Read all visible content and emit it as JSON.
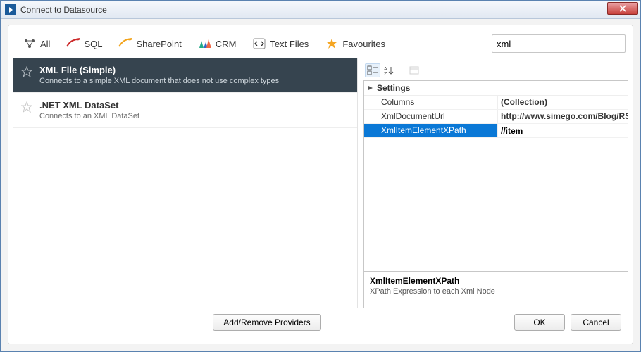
{
  "window": {
    "title": "Connect to Datasource"
  },
  "toolbar": {
    "items": [
      {
        "name": "all",
        "label": "All"
      },
      {
        "name": "sql",
        "label": "SQL"
      },
      {
        "name": "sharepoint",
        "label": "SharePoint"
      },
      {
        "name": "crm",
        "label": "CRM"
      },
      {
        "name": "textfiles",
        "label": "Text Files"
      },
      {
        "name": "favourites",
        "label": "Favourites"
      }
    ],
    "search_value": "xml"
  },
  "providers": [
    {
      "id": "xml-simple",
      "title": "XML File (Simple)",
      "desc": "Connects to a simple XML document that does not use complex types",
      "selected": true
    },
    {
      "id": "net-xml-dataset",
      "title": ".NET XML DataSet",
      "desc": "Connects to an XML DataSet",
      "selected": false
    }
  ],
  "propgrid": {
    "category": "Settings",
    "rows": [
      {
        "name": "Columns",
        "value": "(Collection)",
        "bold": true,
        "selected": false
      },
      {
        "name": "XmlDocumentUrl",
        "value": "http://www.simego.com/Blog/RSS",
        "bold": true,
        "selected": false
      },
      {
        "name": "XmlItemElementXPath",
        "value": "//item",
        "bold": true,
        "selected": true
      }
    ],
    "help": {
      "title": "XmlItemElementXPath",
      "desc": "XPath Expression to each Xml Node"
    }
  },
  "footer": {
    "add_remove": "Add/Remove Providers",
    "ok": "OK",
    "cancel": "Cancel"
  }
}
